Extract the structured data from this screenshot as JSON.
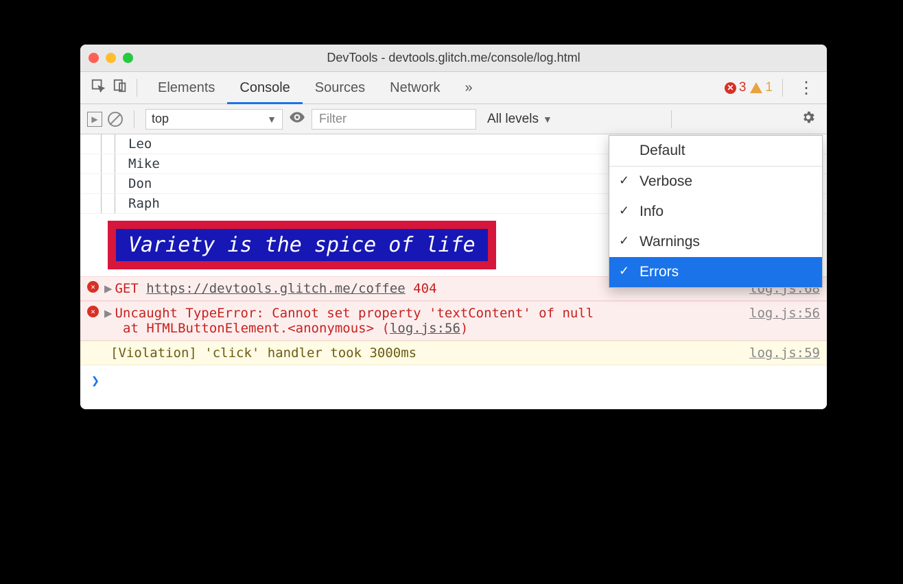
{
  "window": {
    "title": "DevTools - devtools.glitch.me/console/log.html"
  },
  "tabs": {
    "items": [
      "Elements",
      "Console",
      "Sources",
      "Network"
    ],
    "active": "Console",
    "more_glyph": "»"
  },
  "badges": {
    "errors": "3",
    "warnings": "1"
  },
  "console_toolbar": {
    "context": "top",
    "filter_placeholder": "Filter",
    "levels_label": "All levels"
  },
  "levels_menu": {
    "default": "Default",
    "items": [
      {
        "label": "Verbose",
        "checked": true,
        "selected": false
      },
      {
        "label": "Info",
        "checked": true,
        "selected": false
      },
      {
        "label": "Warnings",
        "checked": true,
        "selected": false
      },
      {
        "label": "Errors",
        "checked": true,
        "selected": true
      }
    ]
  },
  "log": {
    "tree": [
      "Leo",
      "Mike",
      "Don",
      "Raph"
    ],
    "styled": "Variety is the spice of life",
    "err1": {
      "method": "GET",
      "url": "https://devtools.glitch.me/coffee",
      "status": "404",
      "source": "log.js:68"
    },
    "err2": {
      "line1": "Uncaught TypeError: Cannot set property 'textContent' of null",
      "line2_pre": "at HTMLButtonElement.<anonymous> (",
      "line2_link": "log.js:56",
      "line2_post": ")",
      "source": "log.js:56"
    },
    "violation": {
      "text": "[Violation] 'click' handler took 3000ms",
      "source": "log.js:59"
    },
    "prompt_glyph": "❯"
  }
}
